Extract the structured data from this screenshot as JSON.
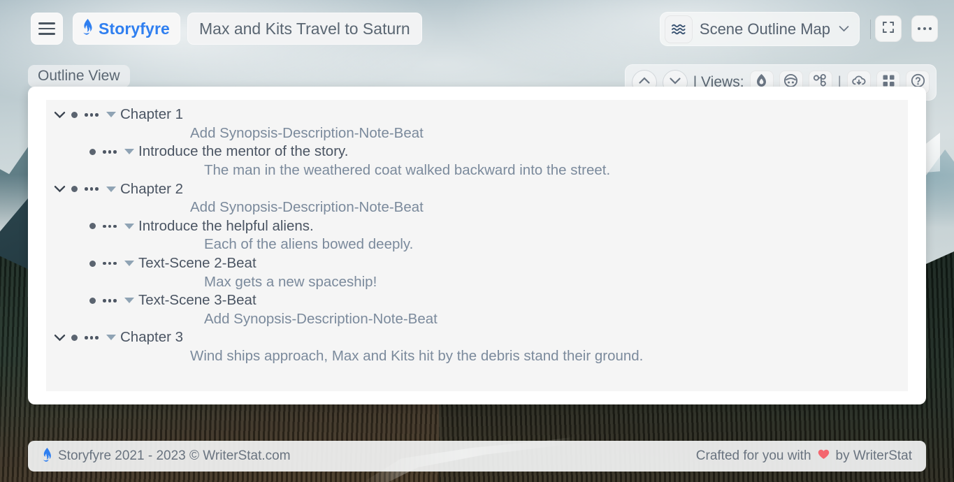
{
  "topbar": {
    "menu_icon": "hamburger-icon",
    "brand": {
      "icon": "flame-icon",
      "label": "Storyfyre",
      "color": "#2f7ff0"
    },
    "project_title": "Max and Kits Travel to Saturn",
    "mode_selector": {
      "icon": "waves-icon",
      "label": "Scene Outline Map",
      "caret": "⌄"
    },
    "fullscreen_icon": "expand-icon",
    "more_icon": "ellipsis-horizontal-icon"
  },
  "secondrow": {
    "view_chip": "Outline View",
    "views_label": "| Views:",
    "nav_up_icon": "chevron-up-icon",
    "nav_down_icon": "chevron-down-icon",
    "pipe": "|",
    "view_buttons": [
      {
        "name": "view-flame",
        "icon": "flame-icon"
      },
      {
        "name": "view-character",
        "icon": "face-circle-icon"
      },
      {
        "name": "view-cluster",
        "icon": "molecule-icon"
      }
    ],
    "tool_buttons": [
      {
        "name": "download",
        "icon": "cloud-download-icon"
      },
      {
        "name": "grid",
        "icon": "grid-squares-icon"
      },
      {
        "name": "help",
        "icon": "question-circle-icon"
      }
    ]
  },
  "outline": {
    "rows": [
      {
        "type": "chapter",
        "label": "Chapter 1"
      },
      {
        "type": "desc1",
        "text": "Add Synopsis-Description-Note-Beat"
      },
      {
        "type": "scene",
        "label": "Introduce the mentor of the story."
      },
      {
        "type": "desc2",
        "text": "The man in the weathered coat walked backward into the street."
      },
      {
        "type": "chapter",
        "label": "Chapter 2"
      },
      {
        "type": "desc1",
        "text": "Add Synopsis-Description-Note-Beat"
      },
      {
        "type": "scene",
        "label": "Introduce the helpful aliens."
      },
      {
        "type": "desc2",
        "text": "Each of the aliens bowed deeply."
      },
      {
        "type": "scene",
        "label": "Text-Scene 2-Beat"
      },
      {
        "type": "desc2",
        "text": "Max gets a new spaceship!"
      },
      {
        "type": "scene",
        "label": "Text-Scene 3-Beat"
      },
      {
        "type": "desc2",
        "text": "Add Synopsis-Description-Note-Beat"
      },
      {
        "type": "chapter",
        "label": "Chapter 3"
      },
      {
        "type": "desc1",
        "text": "Wind ships approach, Max and Kits hit by the debris stand their ground."
      }
    ]
  },
  "footer": {
    "flame_icon": "flame-icon",
    "left_text": "Storyfyre 2021 - 2023 ©  WriterStat.com",
    "right_prefix": "Crafted for you with",
    "heart_icon": "heart-icon",
    "right_suffix": "by WriterStat"
  },
  "colors": {
    "brand_blue": "#2f7ff0",
    "heart_red": "#f4666f",
    "text_primary": "#4b5563",
    "text_secondary": "#7b8a9c",
    "panel_bg": "#f5f5f5",
    "card_bg": "#ffffff"
  }
}
